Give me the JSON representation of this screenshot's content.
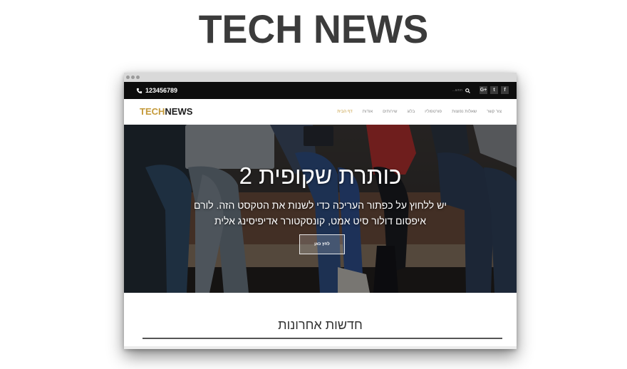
{
  "page_title": "TECH NEWS",
  "site": {
    "topbar": {
      "phone": "123456789",
      "search_placeholder": "חפש...",
      "social": [
        {
          "name": "facebook-icon",
          "glyph": "f"
        },
        {
          "name": "twitter-icon",
          "glyph": "t"
        },
        {
          "name": "google-plus-icon",
          "glyph": "G+"
        }
      ]
    },
    "logo": {
      "part1": "TECH",
      "part2": "NEWS"
    },
    "menu": [
      {
        "label": "דף הבית",
        "active": true
      },
      {
        "label": "אודות"
      },
      {
        "label": "שירותים"
      },
      {
        "label": "בלוג"
      },
      {
        "label": "פורטפוליו"
      },
      {
        "label": "שאלות נפוצות"
      },
      {
        "label": "צור קשר"
      }
    ],
    "hero": {
      "title": "כותרת שקופית 2",
      "text": "יש ללחוץ על כפתור העריכה כדי לשנות את הטקסט הזה. לורם איפסום דולור סיט אמט, קונסקטורר אדיפיסינג אלית",
      "button_label": "לחץ כאן"
    },
    "latest": {
      "title": "חדשות אחרונות"
    }
  },
  "colors": {
    "accent": "#c49a3a",
    "topbar": "#0d0d0d",
    "title": "#3b3b3b"
  }
}
